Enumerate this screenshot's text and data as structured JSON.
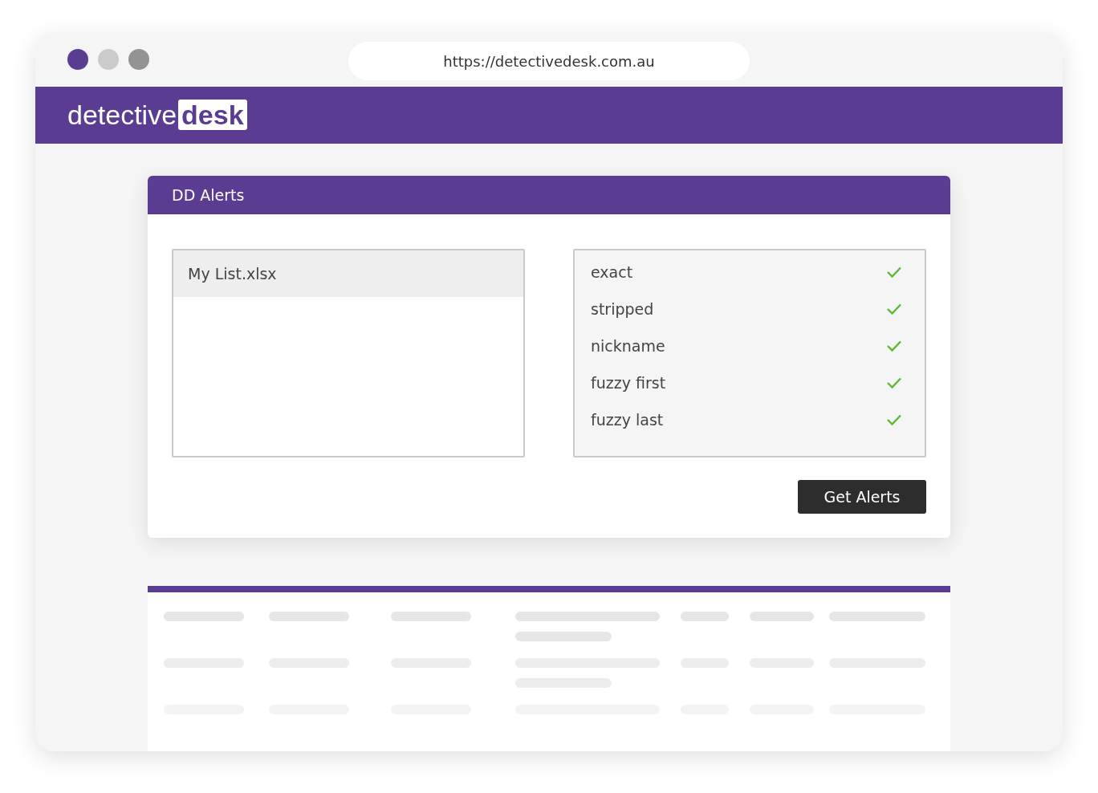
{
  "browser": {
    "url": "https://detectivedesk.com.au"
  },
  "logo": {
    "text": "detective",
    "badge": "desk"
  },
  "card": {
    "title": "DD Alerts"
  },
  "files": [
    {
      "name": "My List.xlsx",
      "selected": true
    }
  ],
  "match_options": [
    {
      "label": "exact",
      "checked": true
    },
    {
      "label": "stripped",
      "checked": true
    },
    {
      "label": "nickname",
      "checked": true
    },
    {
      "label": "fuzzy first",
      "checked": true
    },
    {
      "label": "fuzzy last",
      "checked": true
    }
  ],
  "button": "Get Alerts"
}
